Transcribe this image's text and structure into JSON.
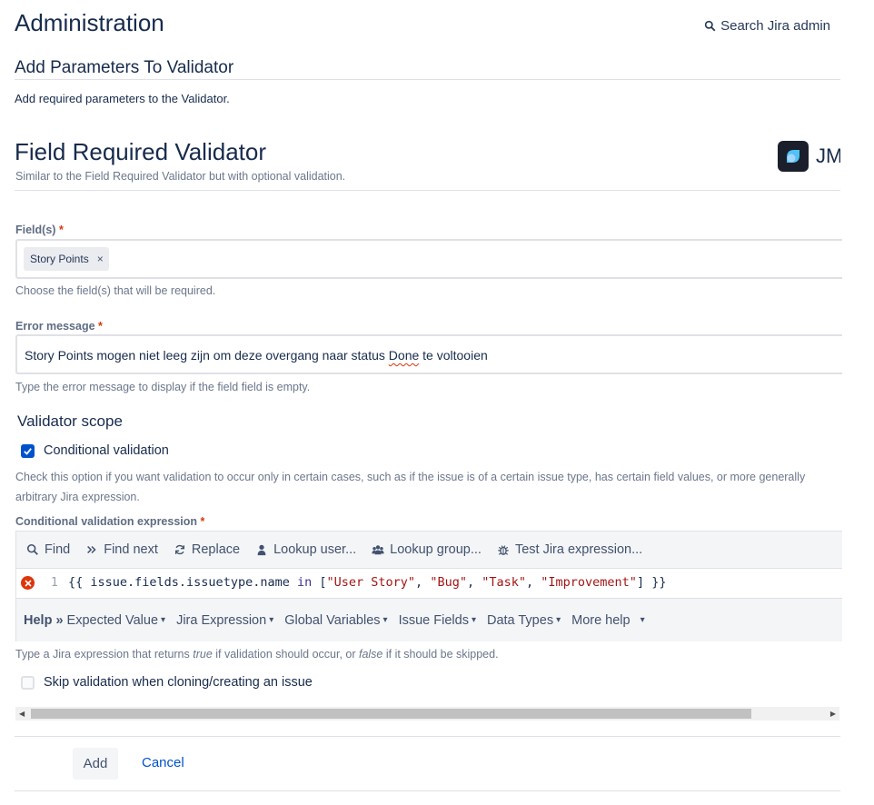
{
  "header": {
    "title": "Administration",
    "search_label": "Search Jira admin"
  },
  "section": {
    "title": "Add Parameters To Validator",
    "description": "Add required parameters to the Validator."
  },
  "validator": {
    "title": "Field Required Validator",
    "subtitle": "Similar to the Field Required Validator but with optional validation.",
    "brand_text": "JMWE"
  },
  "fields": {
    "label": "Field(s)",
    "required_mark": "*",
    "tags": [
      "Story Points"
    ],
    "tag_remove": "×",
    "helper": "Choose the field(s) that will be required."
  },
  "error_message": {
    "label": "Error message",
    "required_mark": "*",
    "value_before": "Story Points mogen niet leeg zijn om deze overgang naar status ",
    "value_misspelled": "Done",
    "value_after": " te voltooien",
    "helper": "Type the error message to display if the field field is empty."
  },
  "scope": {
    "title": "Validator scope",
    "conditional_label": "Conditional validation",
    "conditional_checked": true,
    "conditional_desc": "Check this option if you want validation to occur only in certain cases, such as if the issue is of a certain issue type, has certain field values, or more generally arbitrary Jira expression."
  },
  "expression": {
    "label": "Conditional validation expression",
    "required_mark": "*",
    "toolbar": {
      "find": "Find",
      "find_next": "Find next",
      "replace": "Replace",
      "lookup_user": "Lookup user...",
      "lookup_group": "Lookup group...",
      "test": "Test Jira expression..."
    },
    "line_number": "1",
    "code": {
      "open": "{{ ",
      "path": "issue.fields.issuetype.name ",
      "keyword": "in",
      "bracket_open": " [",
      "str1": "\"User Story\"",
      "sep1": ", ",
      "str2": "\"Bug\"",
      "sep2": ", ",
      "str3": "\"Task\"",
      "sep3": ", ",
      "str4": "\"Improvement\"",
      "close": "] }}"
    },
    "help": {
      "label": "Help",
      "arrows": "»",
      "items": [
        "Expected Value",
        "Jira Expression",
        "Global Variables",
        "Issue Fields",
        "Data Types",
        "More help"
      ]
    },
    "helper_prefix": "Type a Jira expression that returns ",
    "helper_true": "true",
    "helper_mid": " if validation should occur, or ",
    "helper_false": "false",
    "helper_suffix": " if it should be skipped."
  },
  "skip": {
    "label": "Skip validation when cloning/creating an issue",
    "checked": false
  },
  "actions": {
    "add": "Add",
    "cancel": "Cancel"
  },
  "colors": {
    "primary": "#0052cc",
    "text": "#172b4d",
    "subtle": "#6b778c",
    "error": "#de350b",
    "toolbar_bg": "#f4f5f7"
  }
}
